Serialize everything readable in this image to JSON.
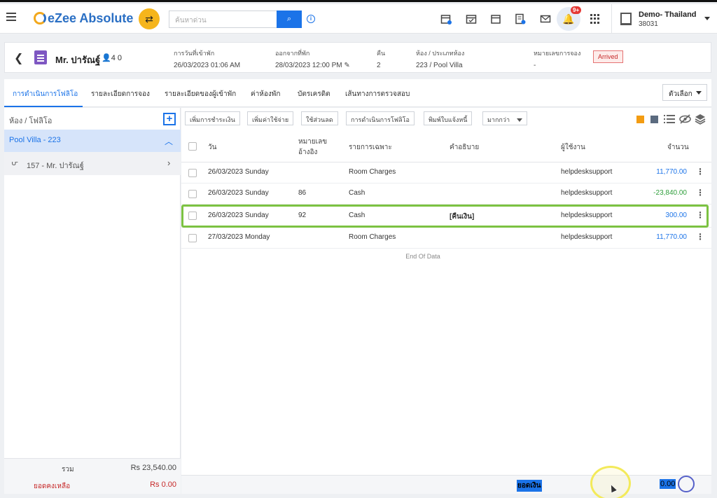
{
  "app": {
    "name": "eZee Absolute",
    "search_placeholder": "ค้นหาด่วน",
    "notification_badge": "9+"
  },
  "icons": [
    "menu-icon",
    "shuffle-icon",
    "search-icon",
    "info-icon",
    "calendar-add-icon",
    "calendar-check-icon",
    "calendar-icon",
    "invoice-icon",
    "mail-icon",
    "bell-icon",
    "apps-icon",
    "hotel-icon"
  ],
  "hotel": {
    "name": "Demo- Thailand",
    "code": "38031"
  },
  "guest": {
    "name": "Mr. ปารัณฐ์",
    "pax": "4  0",
    "checkin_label": "การวันที่เข้าพัก",
    "checkin_value": "26/03/2023 01:06 AM",
    "checkout_label": "ออกจากที่พัก",
    "checkout_value": "28/03/2023 12:00 PM",
    "nights_label": "คืน",
    "nights_value": "2",
    "room_label": "ห้อง / ประเภทห้อง",
    "room_value": "223 / Pool Villa",
    "resno_label": "หมายเลขการจอง",
    "resno_value": "-",
    "status": "Arrived"
  },
  "tabs": [
    "การดำเนินการโฟลิโอ",
    "รายละเอียดการจอง",
    "รายละเอียดของผู้เข้าพัก",
    "ค่าห้องพัก",
    "บัตรเครดิต",
    "เส้นทางการตรวจสอบ"
  ],
  "options_label": "ตัวเลือก",
  "left_panel": {
    "header": "ห้อง / โฟลิโอ",
    "room": "Pool Villa - 223",
    "guest_folio": "157 - Mr. ปารัณฐ์",
    "total_label": "รวม",
    "total_value": "Rs 23,540.00",
    "balance_label": "ยอดคงเหลือ",
    "balance_value": "Rs 0.00"
  },
  "actions": [
    "เพิ่มการชำระเงิน",
    "เพิ่มค่าใช้จ่าย",
    "ใช้ส่วนลด",
    "การดำเนินการโฟลิโอ",
    "พิมพ์ใบแจ้งหนี้",
    "มากกว่า"
  ],
  "table": {
    "headers": {
      "date": "วัน",
      "ref_1": "หมายเลข",
      "ref_2": "อ้างอิง",
      "item": "รายการเฉพาะ",
      "desc": "คำอธิบาย",
      "user": "ผู้ใช้งาน",
      "amount": "จำนวน"
    },
    "rows": [
      {
        "date": "26/03/2023 Sunday",
        "ref": "",
        "item": "Room Charges",
        "desc": "",
        "user": "helpdesksupport",
        "amount": "11,770.00",
        "color": "#1b73e8"
      },
      {
        "date": "26/03/2023 Sunday",
        "ref": "86",
        "item": "Cash",
        "desc": "",
        "user": "helpdesksupport",
        "amount": "-23,840.00",
        "color": "#2e9e3a"
      },
      {
        "date": "26/03/2023 Sunday",
        "ref": "92",
        "item": "Cash",
        "desc": "[คืนเงิน]",
        "user": "helpdesksupport",
        "amount": "300.00",
        "color": "#1b73e8"
      },
      {
        "date": "27/03/2023 Monday",
        "ref": "",
        "item": "Room Charges",
        "desc": "",
        "user": "helpdesksupport",
        "amount": "11,770.00",
        "color": "#1b73e8"
      }
    ],
    "end_text": "End Of Data"
  },
  "footer": {
    "balance_label": "ยอดเงิน",
    "balance_value": "0.00"
  },
  "colors": {
    "accent": "#1b73e8",
    "highlight": "#7cc242",
    "arrived": "#c62828"
  }
}
